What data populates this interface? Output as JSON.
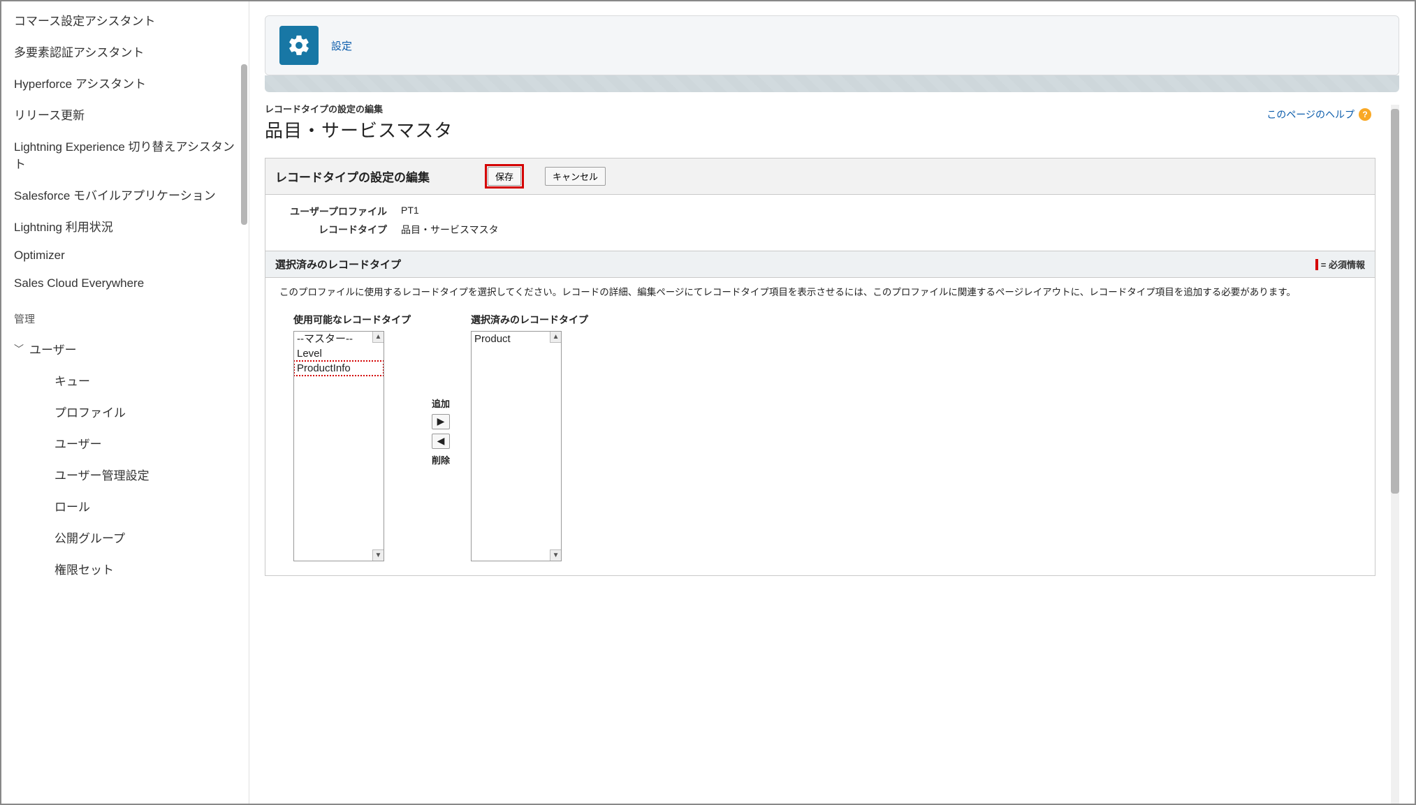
{
  "sidebar": {
    "items": [
      "コマース設定アシスタント",
      "多要素認証アシスタント",
      "Hyperforce アシスタント",
      "リリース更新",
      "Lightning Experience 切り替えアシスタント",
      "Salesforce モバイルアプリケーション",
      "Lightning 利用状況",
      "Optimizer",
      "Sales Cloud Everywhere"
    ],
    "section_label": "管理",
    "expandable": {
      "label": "ユーザー",
      "children": [
        "キュー",
        "プロファイル",
        "ユーザー",
        "ユーザー管理設定",
        "ロール",
        "公開グループ",
        "権限セット"
      ]
    }
  },
  "header": {
    "label": "設定"
  },
  "page": {
    "subtitle": "レコードタイプの設定の編集",
    "title": "品目・サービスマスタ",
    "help": "このページのヘルプ"
  },
  "panel": {
    "title": "レコードタイプの設定の編集",
    "save": "保存",
    "cancel": "キャンセル",
    "profile_label": "ユーザープロファイル",
    "profile_value": "PT1",
    "recordtype_label": "レコードタイプ",
    "recordtype_value": "品目・サービスマスタ",
    "section_title": "選択済みのレコードタイプ",
    "required_label": "= 必須情報",
    "instructions": "このプロファイルに使用するレコードタイプを選択してください。レコードの詳細、編集ページにてレコードタイプ項目を表示させるには、このプロファイルに関連するページレイアウトに、レコードタイプ項目を追加する必要があります。",
    "available_label": "使用可能なレコードタイプ",
    "selected_label": "選択済みのレコードタイプ",
    "available": [
      "--マスター--",
      "Level",
      "ProductInfo"
    ],
    "selected": [
      "Product"
    ],
    "add_label": "追加",
    "remove_label": "削除"
  }
}
